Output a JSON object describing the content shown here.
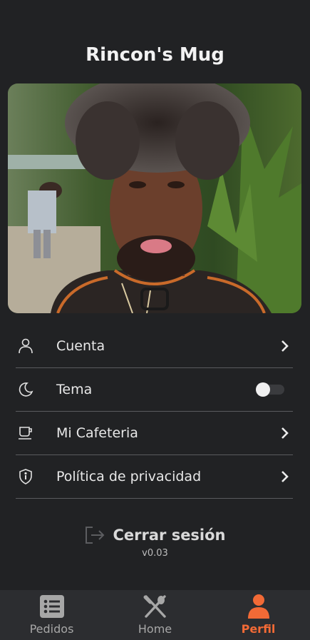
{
  "header": {
    "title": "Rincon's Mug"
  },
  "profile": {
    "photo_alt": "Foto de perfil"
  },
  "menu": {
    "items": [
      {
        "label": "Cuenta",
        "icon": "user-icon",
        "control": "chevron"
      },
      {
        "label": "Tema",
        "icon": "moon-icon",
        "control": "toggle",
        "toggle_on": false
      },
      {
        "label": "Mi Cafeteria",
        "icon": "coffee-cup-icon",
        "control": "chevron"
      },
      {
        "label": "Política de privacidad",
        "icon": "shield-icon",
        "control": "chevron"
      }
    ]
  },
  "logout": {
    "label": "Cerrar sesión",
    "icon": "logout-icon"
  },
  "version": "v0.03",
  "tabbar": {
    "tabs": [
      {
        "label": "Pedidos",
        "icon": "list-icon",
        "active": false
      },
      {
        "label": "Home",
        "icon": "utensils-icon",
        "active": false
      },
      {
        "label": "Perfil",
        "icon": "person-icon",
        "active": true
      }
    ]
  },
  "colors": {
    "background": "#212224",
    "accent": "#f26a36",
    "tabbar": "#2c2d30"
  }
}
